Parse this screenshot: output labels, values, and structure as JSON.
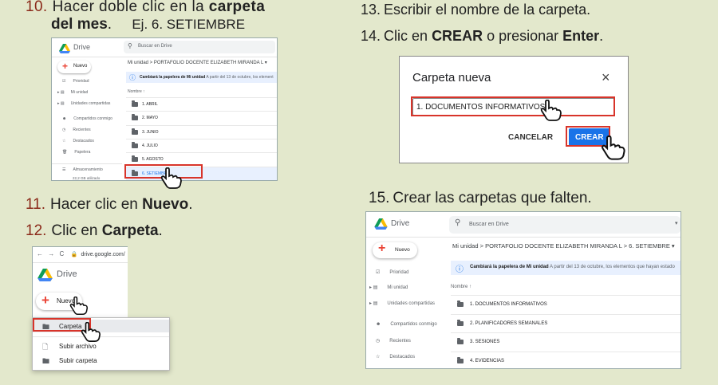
{
  "step10": {
    "num": "10.",
    "text1": "Hacer doble clic en la ",
    "bold1": "carpeta",
    "bold2": "del mes",
    "text2": ".",
    "example": "Ej. 6. SETIEMBRE"
  },
  "step11": {
    "num": "11.",
    "text": "Hacer clic en ",
    "bold": "Nuevo",
    "end": "."
  },
  "step12": {
    "num": "12.",
    "text": "Clic en ",
    "bold": "Carpeta",
    "end": "."
  },
  "step13": {
    "num": "13.",
    "text": "Escribir el nombre de la carpeta."
  },
  "step14": {
    "num": "14.",
    "text1": "Clic en ",
    "bold1": "CREAR",
    "text2": " o presionar ",
    "bold2": "Enter",
    "end": "."
  },
  "step15": {
    "num": "15.",
    "text": "Crear las carpetas que falten."
  },
  "shot1": {
    "app": "Drive",
    "search_placeholder": "Buscar en Drive",
    "new_label": "Nuevo",
    "breadcrumb": "Mi unidad  >  PORTAFOLIO DOCENTE ELIZABETH MIRANDA L  ▾",
    "notice_bold": "Cambiará la papelera de Mi unidad",
    "notice_rest": " A partir del 13 de octubre, los element",
    "sort_label": "Nombre ↑",
    "nav": [
      "Prioridad",
      "Mi unidad",
      "Unidades compartidas",
      "Compartidos conmigo",
      "Recientes",
      "Destacados",
      "Papelera",
      "Almacenamiento"
    ],
    "storage": "22,2 GB utilizado",
    "folders": [
      "1. ABRIL",
      "2. MAYO",
      "3. JUNIO",
      "4. JULIO",
      "5. AGOSTO",
      "6. SETIEMBRE"
    ]
  },
  "shot2": {
    "url": "drive.google.com/",
    "app": "Drive",
    "new_label": "Nuevo",
    "menu": [
      "Carpeta",
      "Subir archivo",
      "Subir carpeta"
    ]
  },
  "dialog": {
    "title": "Carpeta nueva",
    "close": "×",
    "value": "1. DOCUMENTOS INFORMATIVOS",
    "cancel": "CANCELAR",
    "create": "CREAR"
  },
  "shot4": {
    "app": "Drive",
    "search_placeholder": "Buscar en Drive",
    "new_label": "Nuevo",
    "breadcrumb": "Mi unidad  >  PORTAFOLIO DOCENTE ELIZABETH MIRANDA L  >  6. SETIEMBRE  ▾",
    "notice_bold": "Cambiará la papelera de Mi unidad",
    "notice_rest": " A partir del 13 de octubre, los elementos que hayan estado",
    "sort_label": "Nombre ↑",
    "nav": [
      "Prioridad",
      "Mi unidad",
      "Unidades compartidas",
      "Compartidos conmigo",
      "Recientes",
      "Destacados"
    ],
    "folders": [
      "1. DOCUMENTOS INFORMATIVOS",
      "2. PLANIFICADORES SEMANALES",
      "3. SESIONES",
      "4. EVIDENCIAS"
    ]
  },
  "colors": {
    "background": "#e3e8cc",
    "highlight": "#d8342a",
    "button_blue": "#1a73e8",
    "number": "#8b2a1a"
  }
}
